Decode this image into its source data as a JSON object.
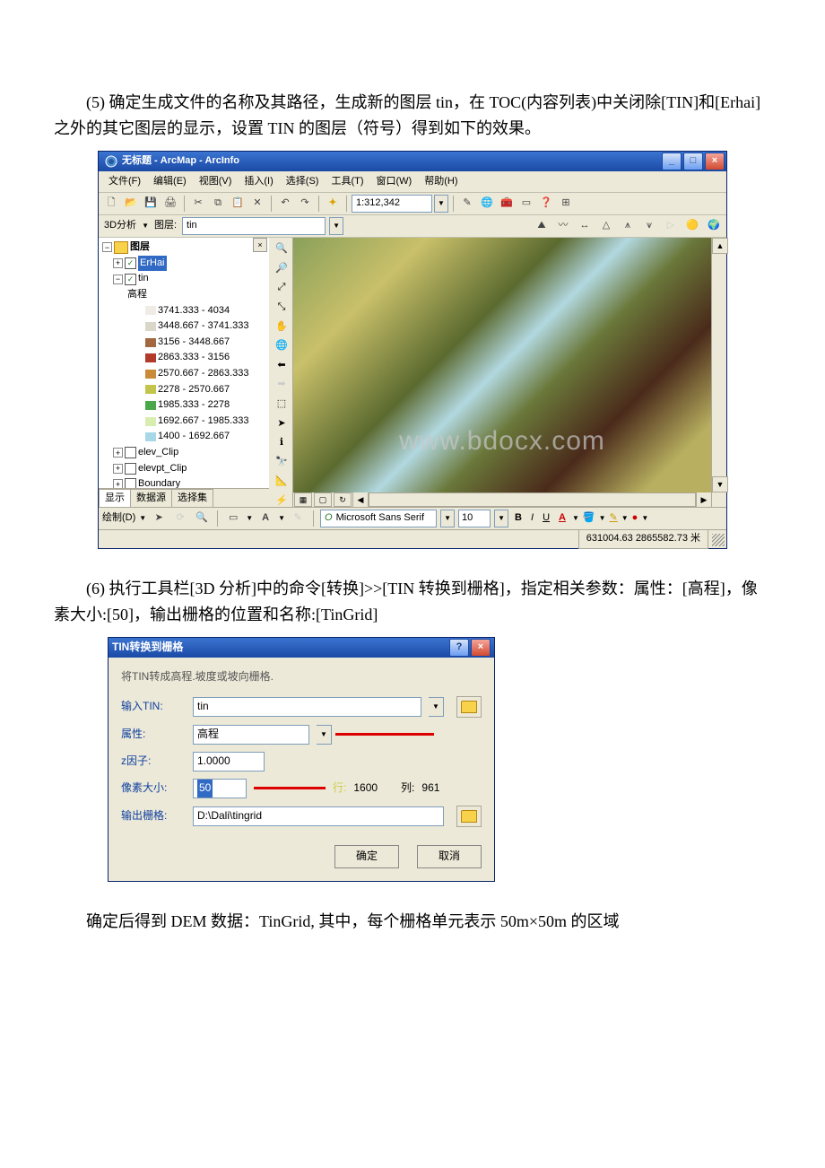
{
  "para1": "(5) 确定生成文件的名称及其路径，生成新的图层 tin，在 TOC(内容列表)中关闭除[TIN]和[Erhai]之外的其它图层的显示，设置 TIN 的图层（符号）得到如下的效果。",
  "para2": "(6) 执行工具栏[3D 分析]中的命令[转换]>>[TIN 转换到栅格]，指定相关参数：属性：[高程]，像素大小:[50]，输出栅格的位置和名称:[TinGrid]",
  "para3": "确定后得到 DEM 数据：TinGrid, 其中，每个栅格单元表示 50m×50m 的区域",
  "arcmap": {
    "title": "无标题 - ArcMap - ArcInfo",
    "menu": [
      "文件(F)",
      "编辑(E)",
      "视图(V)",
      "插入(I)",
      "选择(S)",
      "工具(T)",
      "窗口(W)",
      "帮助(H)"
    ],
    "scale": "1:312,342",
    "toolbar2_label": "3D分析",
    "layer_label": "图层:",
    "layer_value": "tin",
    "toc": {
      "root": "图层",
      "erhai": "ErHai",
      "tin": "tin",
      "elev_title": "高程",
      "classes": [
        {
          "label": "3741.333 - 4034",
          "color": "#efece6"
        },
        {
          "label": "3448.667 - 3741.333",
          "color": "#d9d7c9"
        },
        {
          "label": "3156 - 3448.667",
          "color": "#a2683f"
        },
        {
          "label": "2863.333 - 3156",
          "color": "#b13a2a"
        },
        {
          "label": "2570.667 - 2863.333",
          "color": "#c98a3a"
        },
        {
          "label": "2278 - 2570.667",
          "color": "#c3c44a"
        },
        {
          "label": "1985.333 - 2278",
          "color": "#4aa84a"
        },
        {
          "label": "1692.667 - 1985.333",
          "color": "#d8eeb0"
        },
        {
          "label": "1400 - 1692.667",
          "color": "#a8d8e8"
        }
      ],
      "other_layers": [
        "elev_Clip",
        "elevpt_Clip",
        "Boundary"
      ],
      "tabs": [
        "显示",
        "数据源",
        "选择集"
      ]
    },
    "watermark": "www.bdocx.com",
    "draw_label": "绘制(D)",
    "font_name": "Microsoft Sans Serif",
    "font_size": "10",
    "status": "631004.63 2865582.73 米"
  },
  "dialog": {
    "title": "TIN转换到栅格",
    "desc": "将TIN转成高程.坡度或坡向栅格.",
    "rows": {
      "input_tin": {
        "label": "输入TIN:",
        "value": "tin"
      },
      "attr": {
        "label": "属性:",
        "value": "高程"
      },
      "zfactor": {
        "label": "z因子:",
        "value": "1.0000"
      },
      "pixel": {
        "label": "像素大小:",
        "value": "50",
        "rows_label": "行:",
        "rows_value": "1600",
        "cols_label": "列:",
        "cols_value": "961"
      },
      "output": {
        "label": "输出栅格:",
        "value": "D:\\Dali\\tingrid"
      }
    },
    "ok": "确定",
    "cancel": "取消"
  }
}
